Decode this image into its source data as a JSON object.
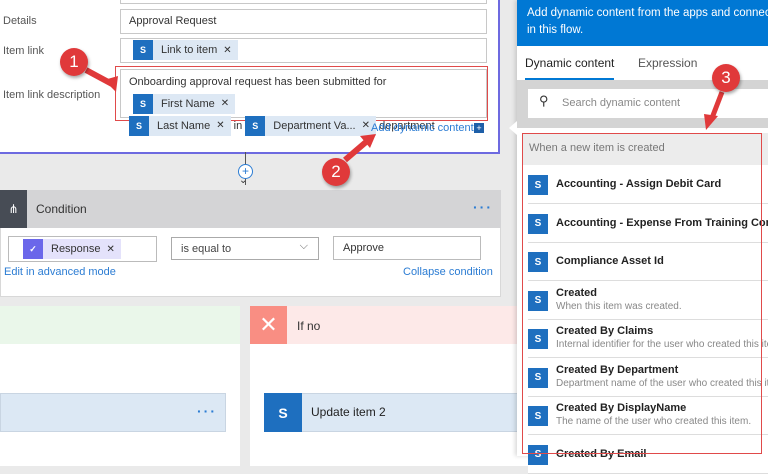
{
  "card": {
    "details_label": "Details",
    "details_value": "Approval Request",
    "item_link_label": "Item link",
    "item_link_token": "Link to item",
    "desc_label": "Item link description",
    "desc_text1": "Onboarding approval request has been submitted for",
    "desc_token1": "First Name",
    "desc_token2": "Last Name",
    "desc_text2": "in",
    "desc_token3": "Department Va...",
    "desc_text3": "department",
    "add_dynamic": "Add dynamic content"
  },
  "condition": {
    "title": "Condition",
    "token": "Response",
    "operator": "is equal to",
    "value": "Approve",
    "edit_advanced": "Edit in advanced mode",
    "collapse": "Collapse condition"
  },
  "branches": {
    "no_label": "If no",
    "no_action": "Update item 2"
  },
  "panel": {
    "header": "Add dynamic content from the apps and connectors used in this flow.",
    "tabs": [
      "Dynamic content",
      "Expression"
    ],
    "search_placeholder": "Search dynamic content",
    "section": "When a new item is created",
    "items": [
      {
        "title": "Accounting - Assign Debit Card"
      },
      {
        "title": "Accounting - Expense From Training Complete"
      },
      {
        "title": "Compliance Asset Id"
      },
      {
        "title": "Created",
        "desc": "When this item was created."
      },
      {
        "title": "Created By Claims",
        "desc": "Internal identifier for the user who created this item."
      },
      {
        "title": "Created By Department",
        "desc": "Department name of the user who created this item."
      },
      {
        "title": "Created By DisplayName",
        "desc": "The name of the user who created this item."
      },
      {
        "title": "Created By Email"
      }
    ]
  },
  "annotations": [
    "1",
    "2",
    "3"
  ],
  "colors": {
    "accent": "#0078d4",
    "annotation": "#e0393a",
    "no_branch": "#f98e83",
    "yes_branch": "#eaf7ea"
  }
}
